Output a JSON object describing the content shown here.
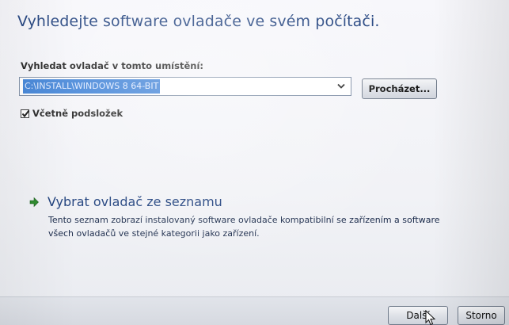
{
  "dialog": {
    "heading": "Vyhledejte software ovladače ve svém počítači.",
    "location_label": "Vyhledat ovladač v tomto umístění:",
    "location_value": "C:\\INSTALL\\WINDOWS 8 64-BIT",
    "browse_label": "Procházet...",
    "include_subfolders_label": "Včetně podsložek",
    "include_subfolders_checked": true,
    "pick_from_list": {
      "title": "Vybrat ovladač ze seznamu",
      "description": "Tento seznam zobrazí instalovaný software ovladače kompatibilní se zařízením a software všech ovladačů ve stejné kategorii jako zařízení."
    }
  },
  "footer": {
    "next_label": "Další",
    "cancel_label": "Storno"
  },
  "colors": {
    "heading": "#1a3c7a",
    "selection": "#3a7fd6",
    "arrow_green": "#2e8b2e"
  },
  "icons": {
    "combo_arrow": "chevron-down-icon",
    "checkbox": "checkmark-icon",
    "link_arrow": "green-arrow-right-icon",
    "cursor": "mouse-pointer-icon"
  }
}
